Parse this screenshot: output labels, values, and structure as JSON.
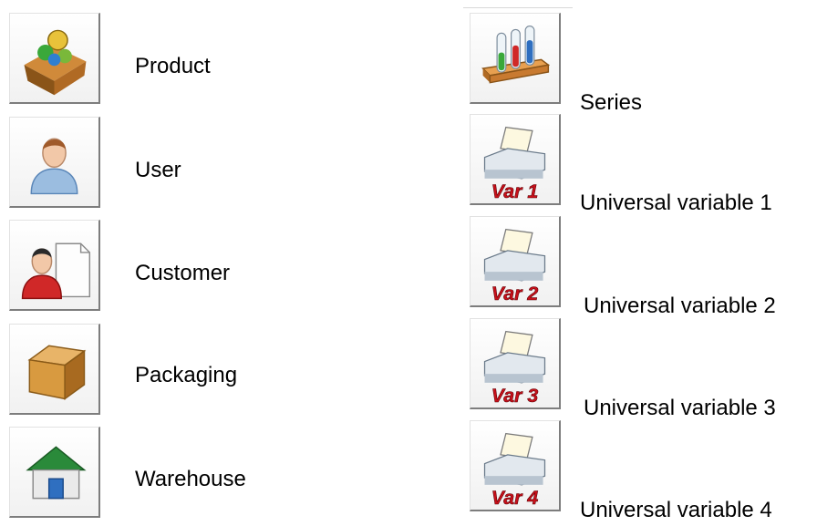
{
  "left_column": {
    "items": [
      {
        "label": "Product",
        "icon": "product-box-icon"
      },
      {
        "label": "User",
        "icon": "user-icon"
      },
      {
        "label": "Customer",
        "icon": "customer-icon"
      },
      {
        "label": "Packaging",
        "icon": "packaging-box-icon"
      },
      {
        "label": "Warehouse",
        "icon": "warehouse-icon"
      }
    ]
  },
  "right_column": {
    "items": [
      {
        "label": "Series",
        "icon": "test-tubes-icon"
      },
      {
        "label": "Universal variable 1",
        "icon": "printer-icon",
        "badge": "Var 1"
      },
      {
        "label": "Universal variable 2",
        "icon": "printer-icon",
        "badge": "Var 2"
      },
      {
        "label": "Universal variable 3",
        "icon": "printer-icon",
        "badge": "Var 3"
      },
      {
        "label": "Universal variable 4",
        "icon": "printer-icon",
        "badge": "Var 4"
      }
    ]
  },
  "colors": {
    "badge_text": "#c8101a",
    "button_border": "#7d7d7d"
  }
}
